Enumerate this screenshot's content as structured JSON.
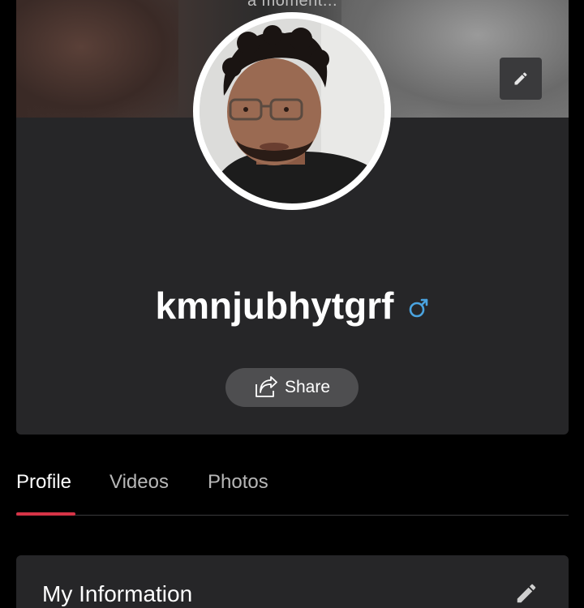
{
  "cover": {
    "caption": "a moment...",
    "edit_icon": "pencil-icon"
  },
  "profile": {
    "avatar_icon": "user-photo",
    "username": "kmnjubhytgrf",
    "gender_icon": "male-icon",
    "gender_color": "#4aa3df",
    "share_label": "Share",
    "share_icon": "share-icon"
  },
  "tabs": [
    {
      "label": "Profile",
      "active": true
    },
    {
      "label": "Videos",
      "active": false
    },
    {
      "label": "Photos",
      "active": false
    }
  ],
  "accent": "#d63447",
  "info": {
    "title": "My Information",
    "edit_icon": "pencil-icon"
  }
}
